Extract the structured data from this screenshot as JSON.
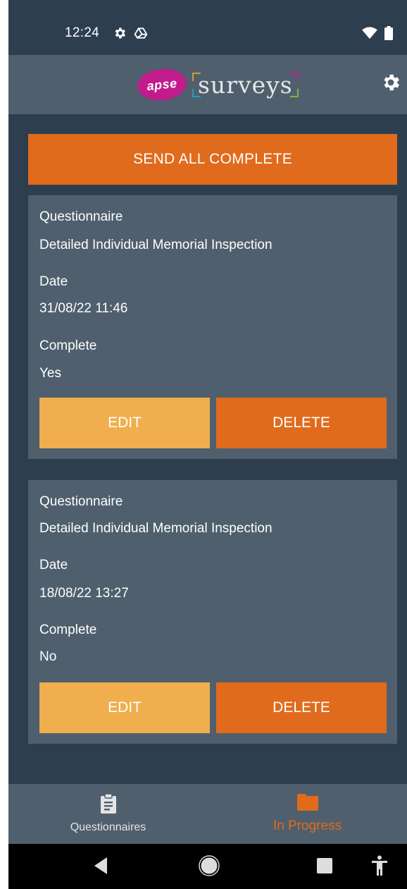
{
  "status_bar": {
    "time": "12:24",
    "icons_left": [
      "gear-icon",
      "drive-icon"
    ],
    "icons_right": [
      "wifi-icon",
      "battery-icon"
    ]
  },
  "header": {
    "logo_badge": "apse",
    "logo_text": "surveys",
    "settings_icon": "gear-icon"
  },
  "actions": {
    "send_all_label": "SEND ALL COMPLETE"
  },
  "surveys": [
    {
      "questionnaire_label": "Questionnaire",
      "questionnaire_value": "Detailed Individual Memorial Inspection",
      "date_label": "Date",
      "date_value": "31/08/22 11:46",
      "complete_label": "Complete",
      "complete_value": "Yes",
      "edit_label": "EDIT",
      "delete_label": "DELETE"
    },
    {
      "questionnaire_label": "Questionnaire",
      "questionnaire_value": "Detailed Individual Memorial Inspection",
      "date_label": "Date",
      "date_value": "18/08/22 13:27",
      "complete_label": "Complete",
      "complete_value": "No",
      "edit_label": "EDIT",
      "delete_label": "DELETE"
    }
  ],
  "bottom_nav": {
    "tabs": [
      {
        "label": "Questionnaires",
        "icon": "clipboard-icon",
        "active": false
      },
      {
        "label": "In Progress",
        "icon": "folder-icon",
        "active": true
      }
    ]
  },
  "colors": {
    "background": "#2d3e4f",
    "card": "#4f5f6d",
    "accent_orange": "#e06b1c",
    "edit_yellow": "#f0ae4e",
    "brand_magenta": "#c21b8c"
  }
}
